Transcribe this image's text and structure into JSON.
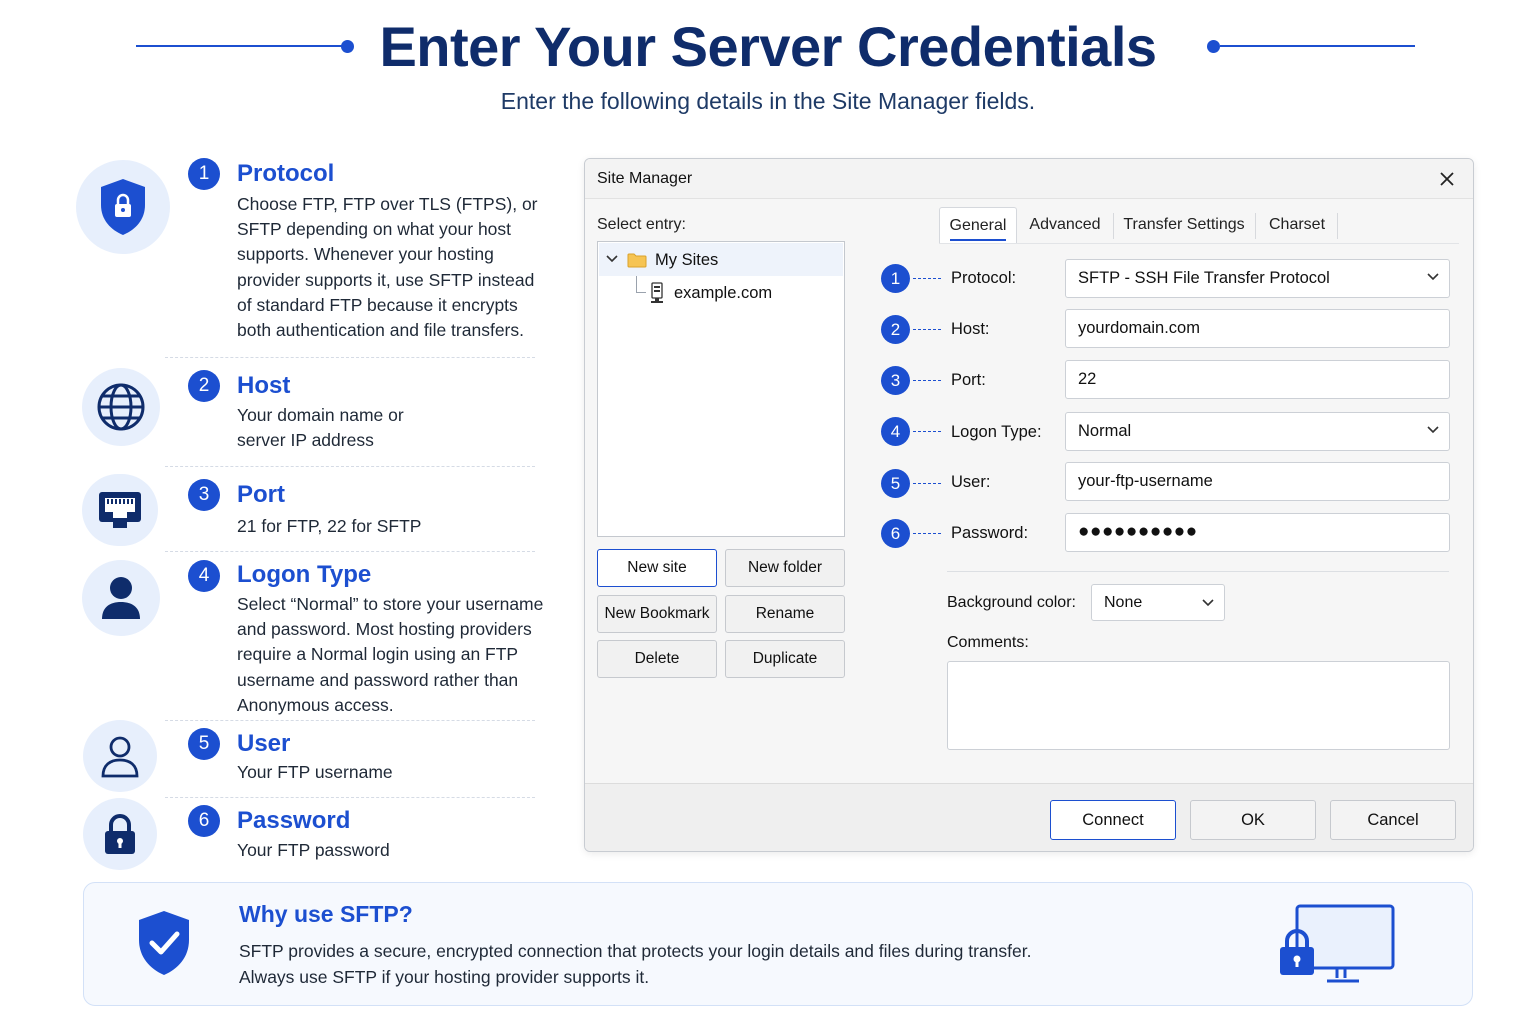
{
  "header": {
    "title": "Enter Your Server Credentials",
    "subtitle": "Enter the following details in the Site Manager fields."
  },
  "colors": {
    "accent": "#1c4fd0",
    "title": "#0f2c6b",
    "icon_bg": "#e7effc"
  },
  "steps": [
    {
      "number": "1",
      "title": "Protocol",
      "icon": "shield-lock-icon",
      "description": "Choose FTP, FTP over TLS (FTPS), or SFTP depending on what your host supports. Whenever your hosting provider supports it, use SFTP instead of standard FTP because it encrypts both authentication and file transfers."
    },
    {
      "number": "2",
      "title": "Host",
      "icon": "globe-icon",
      "description": "Your domain name or server IP address"
    },
    {
      "number": "3",
      "title": "Port",
      "icon": "network-port-icon",
      "description": "21 for FTP, 22 for SFTP"
    },
    {
      "number": "4",
      "title": "Logon Type",
      "icon": "user-icon",
      "description": "Select “Normal” to store your username and password. Most hosting providers require a Normal login using an FTP username and password rather than Anonymous access."
    },
    {
      "number": "5",
      "title": "User",
      "icon": "user-outline-icon",
      "description": "Your FTP username"
    },
    {
      "number": "6",
      "title": "Password",
      "icon": "padlock-icon",
      "description": "Your FTP password"
    }
  ],
  "dialog": {
    "title": "Site Manager",
    "close_icon": "close-icon",
    "select_entry_label": "Select entry:",
    "tree": {
      "root": "My Sites",
      "child": "example.com"
    },
    "buttons": {
      "new_site": "New site",
      "new_folder": "New folder",
      "new_bookmark": "New Bookmark",
      "rename": "Rename",
      "delete": "Delete",
      "duplicate": "Duplicate"
    },
    "tabs": [
      "General",
      "Advanced",
      "Transfer Settings",
      "Charset"
    ],
    "active_tab": "General",
    "fields": [
      {
        "number": "1",
        "label": "Protocol:",
        "value": "SFTP - SSH File Transfer Protocol",
        "kind": "select"
      },
      {
        "number": "2",
        "label": "Host:",
        "value": "yourdomain.com",
        "kind": "text"
      },
      {
        "number": "3",
        "label": "Port:",
        "value": "22",
        "kind": "text"
      },
      {
        "number": "4",
        "label": "Logon Type:",
        "value": "Normal",
        "kind": "select"
      },
      {
        "number": "5",
        "label": "User:",
        "value": "your-ftp-username",
        "kind": "text"
      },
      {
        "number": "6",
        "label": "Password:",
        "value": "●●●●●●●●●●",
        "kind": "password"
      }
    ],
    "background_color_label": "Background color:",
    "background_color_value": "None",
    "comments_label": "Comments:",
    "footer": {
      "connect": "Connect",
      "ok": "OK",
      "cancel": "Cancel"
    }
  },
  "why": {
    "title": "Why use SFTP?",
    "line1": "SFTP provides a secure, encrypted connection that protects your login details and files during transfer.",
    "line2": "Always use SFTP if your hosting provider supports it."
  }
}
